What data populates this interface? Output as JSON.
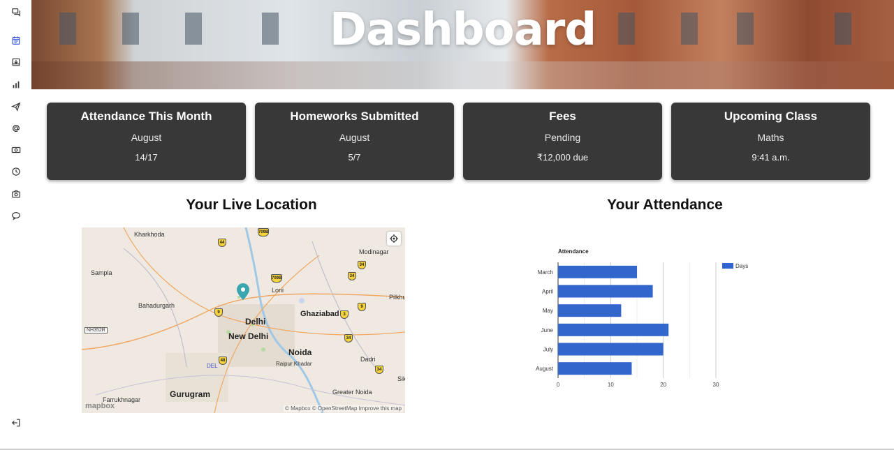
{
  "hero": {
    "title": "Dashboard"
  },
  "sidebar": {
    "items": [
      {
        "icon": "chat-bubbles-icon"
      },
      {
        "icon": "calendar-icon",
        "active": true
      },
      {
        "icon": "inbox-download-icon"
      },
      {
        "icon": "bar-chart-icon"
      },
      {
        "icon": "paper-plane-icon"
      },
      {
        "icon": "at-sign-icon"
      },
      {
        "icon": "money-icon"
      },
      {
        "icon": "clock-icon"
      },
      {
        "icon": "camera-icon"
      },
      {
        "icon": "comment-icon"
      },
      {
        "icon": "logout-icon"
      }
    ]
  },
  "cards": [
    {
      "title": "Attendance This Month",
      "subtitle": "August",
      "value": "14/17"
    },
    {
      "title": "Homeworks Submitted",
      "subtitle": "August",
      "value": "5/7"
    },
    {
      "title": "Fees",
      "subtitle": "Pending",
      "value": "₹12,000 due"
    },
    {
      "title": "Upcoming Class",
      "subtitle": "Maths",
      "value": "9:41 a.m."
    }
  ],
  "location": {
    "title": "Your Live Location",
    "map": {
      "places": [
        "Kharkhoda",
        "Sampla",
        "Bahadurgarh",
        "Delhi",
        "New Delhi",
        "Ghaziabad",
        "Noida",
        "Gurugram",
        "Modinagar",
        "Loni",
        "Pilkhu",
        "Dadri",
        "Greater Noida",
        "Farrukhnagar",
        "Raipur Khadar",
        "DEL",
        "NH352R",
        "Sik"
      ],
      "shields": [
        "709B",
        "44",
        "709B",
        "34",
        "9",
        "9",
        "34",
        "48",
        "34",
        "3",
        "34"
      ],
      "attribution": "© Mapbox © OpenStreetMap Improve this map",
      "logo": "mapbox"
    }
  },
  "attendance": {
    "title": "Your Attendance",
    "chart_data": {
      "type": "bar",
      "orientation": "horizontal",
      "title": "Attendance",
      "categories": [
        "March",
        "April",
        "May",
        "June",
        "July",
        "August"
      ],
      "series": [
        {
          "name": "Days",
          "values": [
            15,
            18,
            12,
            21,
            20,
            14
          ],
          "color": "#3366cc"
        }
      ],
      "xlim": [
        0,
        30
      ],
      "xticks": [
        0,
        10,
        20,
        30
      ],
      "grid": true,
      "legend": "right"
    }
  },
  "colors": {
    "card_bg": "#383838",
    "accent": "#3d5bd9",
    "bar": "#3366cc"
  }
}
